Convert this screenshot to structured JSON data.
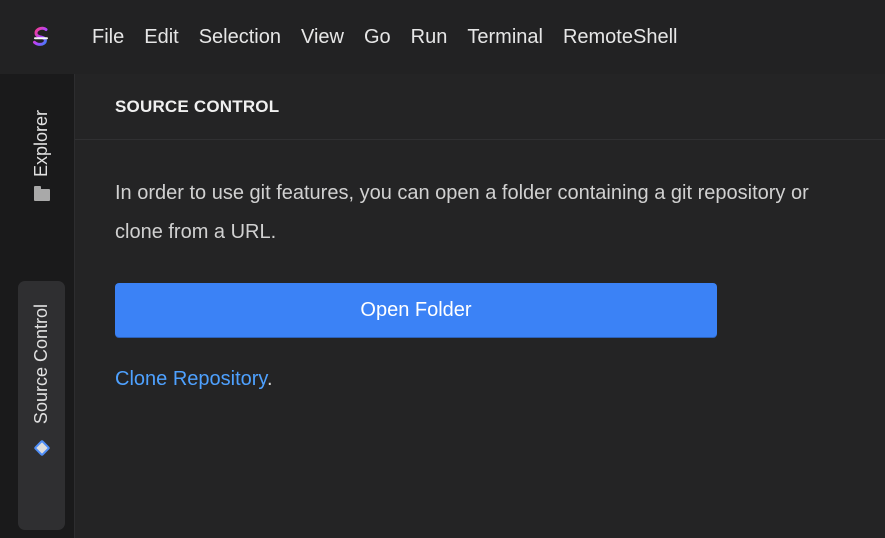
{
  "menu": {
    "items": [
      {
        "label": "File"
      },
      {
        "label": "Edit"
      },
      {
        "label": "Selection"
      },
      {
        "label": "View"
      },
      {
        "label": "Go"
      },
      {
        "label": "Run"
      },
      {
        "label": "Terminal"
      },
      {
        "label": "RemoteShell"
      }
    ]
  },
  "activity": {
    "explorer_label": "Explorer",
    "source_control_label": "Source Control",
    "explorer_icon": "folder-icon",
    "source_control_icon": "git-icon"
  },
  "panel": {
    "title": "SOURCE CONTROL",
    "message": "In order to use git features, you can open a folder containing a git repository or clone from a URL.",
    "open_button": "Open Folder",
    "clone_link": "Clone Repository",
    "clone_suffix": "."
  },
  "colors": {
    "accent": "#3b82f6",
    "link": "#4ea1ff",
    "background": "#1f1f20"
  }
}
